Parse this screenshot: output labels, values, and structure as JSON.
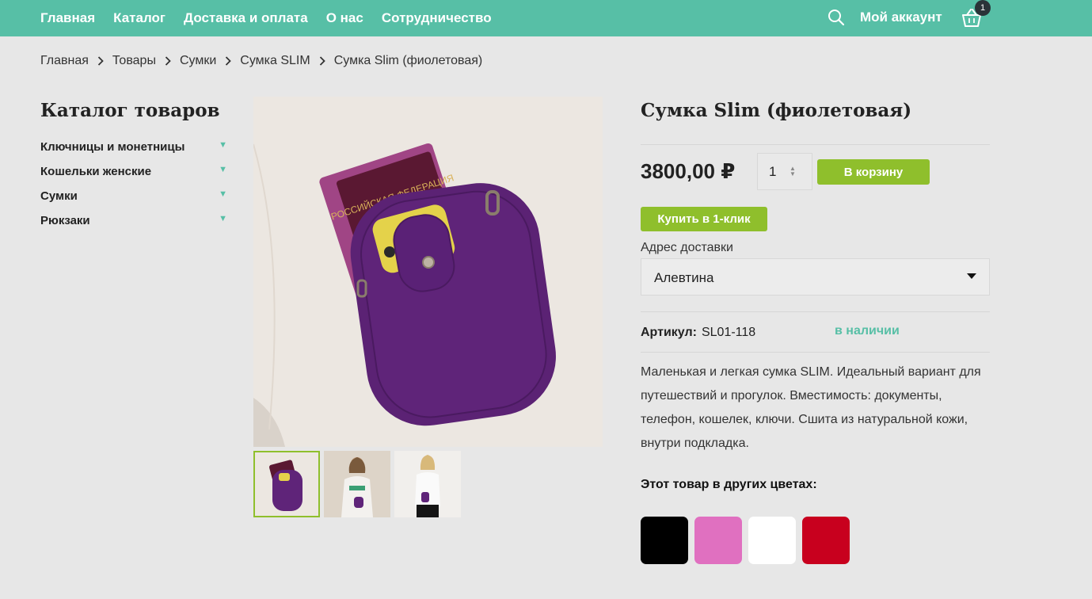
{
  "nav": {
    "items": [
      "Главная",
      "Каталог",
      "Доставка и оплата",
      "О нас",
      "Сотрудничество"
    ],
    "account_label": "Мой аккаунт",
    "cart_count": "1"
  },
  "breadcrumb": [
    "Главная",
    "Товары",
    "Сумки",
    "Сумка SLIM",
    "Сумка Slim (фиолетовая)"
  ],
  "sidebar": {
    "title": "Каталог товаров",
    "items": [
      "Ключницы и монетницы",
      "Кошельки женские",
      "Сумки",
      "Рюкзаки"
    ]
  },
  "product": {
    "title": "Сумка Slim (фиолетовая)",
    "price": "3800,00 ₽",
    "quantity": "1",
    "add_to_cart_label": "В корзину",
    "buy_one_click_label": "Купить в 1-клик",
    "delivery_label": "Адрес доставки",
    "delivery_value": "Алевтина",
    "article_label": "Артикул:",
    "article_code": "SL01-118",
    "stock_status": "в наличии",
    "description": "Маленькая и легкая сумка SLIM. Идеальный вариант для путешествий и прогулок. Вместимость: документы, телефон, кошелек, ключи. Сшита из натуральной кожи, внутри подкладка.",
    "passport_text": "РОССИЙСКАЯ ФЕДЕРАЦИЯ"
  },
  "other_colors": {
    "title": "Этот товар в других цветах:",
    "swatches": [
      "#000000",
      "#e070c0",
      "#ffffff",
      "#c8001e"
    ]
  },
  "colors": {
    "accent": "#57bfa6",
    "button": "#8fbf2c"
  },
  "icons": [
    "search-icon",
    "cart-icon",
    "chevron-right-icon",
    "triangle-down-icon",
    "caret-down-icon"
  ]
}
